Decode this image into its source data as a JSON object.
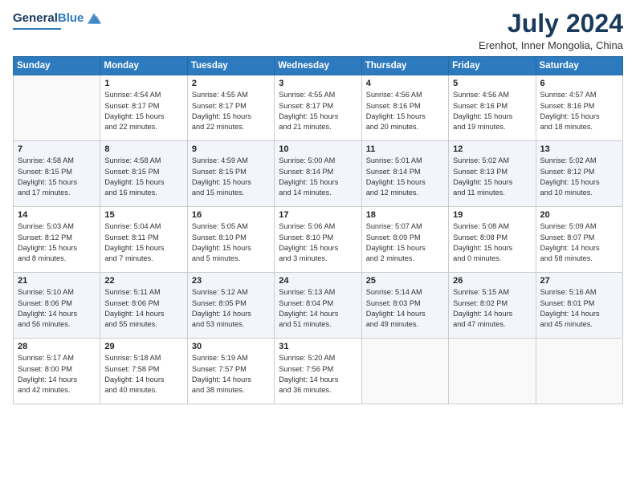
{
  "logo": {
    "line1": "General",
    "line2": "Blue"
  },
  "title": "July 2024",
  "subtitle": "Erenhot, Inner Mongolia, China",
  "header_days": [
    "Sunday",
    "Monday",
    "Tuesday",
    "Wednesday",
    "Thursday",
    "Friday",
    "Saturday"
  ],
  "weeks": [
    [
      {
        "day": "",
        "content": ""
      },
      {
        "day": "1",
        "content": "Sunrise: 4:54 AM\nSunset: 8:17 PM\nDaylight: 15 hours\nand 22 minutes."
      },
      {
        "day": "2",
        "content": "Sunrise: 4:55 AM\nSunset: 8:17 PM\nDaylight: 15 hours\nand 22 minutes."
      },
      {
        "day": "3",
        "content": "Sunrise: 4:55 AM\nSunset: 8:17 PM\nDaylight: 15 hours\nand 21 minutes."
      },
      {
        "day": "4",
        "content": "Sunrise: 4:56 AM\nSunset: 8:16 PM\nDaylight: 15 hours\nand 20 minutes."
      },
      {
        "day": "5",
        "content": "Sunrise: 4:56 AM\nSunset: 8:16 PM\nDaylight: 15 hours\nand 19 minutes."
      },
      {
        "day": "6",
        "content": "Sunrise: 4:57 AM\nSunset: 8:16 PM\nDaylight: 15 hours\nand 18 minutes."
      }
    ],
    [
      {
        "day": "7",
        "content": "Sunrise: 4:58 AM\nSunset: 8:15 PM\nDaylight: 15 hours\nand 17 minutes."
      },
      {
        "day": "8",
        "content": "Sunrise: 4:58 AM\nSunset: 8:15 PM\nDaylight: 15 hours\nand 16 minutes."
      },
      {
        "day": "9",
        "content": "Sunrise: 4:59 AM\nSunset: 8:15 PM\nDaylight: 15 hours\nand 15 minutes."
      },
      {
        "day": "10",
        "content": "Sunrise: 5:00 AM\nSunset: 8:14 PM\nDaylight: 15 hours\nand 14 minutes."
      },
      {
        "day": "11",
        "content": "Sunrise: 5:01 AM\nSunset: 8:14 PM\nDaylight: 15 hours\nand 12 minutes."
      },
      {
        "day": "12",
        "content": "Sunrise: 5:02 AM\nSunset: 8:13 PM\nDaylight: 15 hours\nand 11 minutes."
      },
      {
        "day": "13",
        "content": "Sunrise: 5:02 AM\nSunset: 8:12 PM\nDaylight: 15 hours\nand 10 minutes."
      }
    ],
    [
      {
        "day": "14",
        "content": "Sunrise: 5:03 AM\nSunset: 8:12 PM\nDaylight: 15 hours\nand 8 minutes."
      },
      {
        "day": "15",
        "content": "Sunrise: 5:04 AM\nSunset: 8:11 PM\nDaylight: 15 hours\nand 7 minutes."
      },
      {
        "day": "16",
        "content": "Sunrise: 5:05 AM\nSunset: 8:10 PM\nDaylight: 15 hours\nand 5 minutes."
      },
      {
        "day": "17",
        "content": "Sunrise: 5:06 AM\nSunset: 8:10 PM\nDaylight: 15 hours\nand 3 minutes."
      },
      {
        "day": "18",
        "content": "Sunrise: 5:07 AM\nSunset: 8:09 PM\nDaylight: 15 hours\nand 2 minutes."
      },
      {
        "day": "19",
        "content": "Sunrise: 5:08 AM\nSunset: 8:08 PM\nDaylight: 15 hours\nand 0 minutes."
      },
      {
        "day": "20",
        "content": "Sunrise: 5:09 AM\nSunset: 8:07 PM\nDaylight: 14 hours\nand 58 minutes."
      }
    ],
    [
      {
        "day": "21",
        "content": "Sunrise: 5:10 AM\nSunset: 8:06 PM\nDaylight: 14 hours\nand 56 minutes."
      },
      {
        "day": "22",
        "content": "Sunrise: 5:11 AM\nSunset: 8:06 PM\nDaylight: 14 hours\nand 55 minutes."
      },
      {
        "day": "23",
        "content": "Sunrise: 5:12 AM\nSunset: 8:05 PM\nDaylight: 14 hours\nand 53 minutes."
      },
      {
        "day": "24",
        "content": "Sunrise: 5:13 AM\nSunset: 8:04 PM\nDaylight: 14 hours\nand 51 minutes."
      },
      {
        "day": "25",
        "content": "Sunrise: 5:14 AM\nSunset: 8:03 PM\nDaylight: 14 hours\nand 49 minutes."
      },
      {
        "day": "26",
        "content": "Sunrise: 5:15 AM\nSunset: 8:02 PM\nDaylight: 14 hours\nand 47 minutes."
      },
      {
        "day": "27",
        "content": "Sunrise: 5:16 AM\nSunset: 8:01 PM\nDaylight: 14 hours\nand 45 minutes."
      }
    ],
    [
      {
        "day": "28",
        "content": "Sunrise: 5:17 AM\nSunset: 8:00 PM\nDaylight: 14 hours\nand 42 minutes."
      },
      {
        "day": "29",
        "content": "Sunrise: 5:18 AM\nSunset: 7:58 PM\nDaylight: 14 hours\nand 40 minutes."
      },
      {
        "day": "30",
        "content": "Sunrise: 5:19 AM\nSunset: 7:57 PM\nDaylight: 14 hours\nand 38 minutes."
      },
      {
        "day": "31",
        "content": "Sunrise: 5:20 AM\nSunset: 7:56 PM\nDaylight: 14 hours\nand 36 minutes."
      },
      {
        "day": "",
        "content": ""
      },
      {
        "day": "",
        "content": ""
      },
      {
        "day": "",
        "content": ""
      }
    ]
  ]
}
